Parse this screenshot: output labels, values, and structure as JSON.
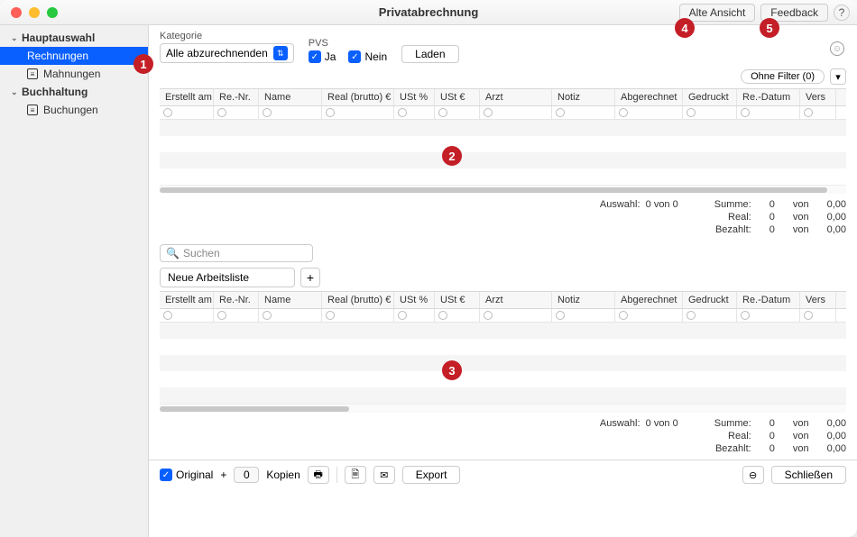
{
  "window_title": "Privatabrechnung",
  "titlebar_buttons": {
    "old_view": "Alte Ansicht",
    "feedback": "Feedback"
  },
  "sidebar": {
    "groups": [
      {
        "label": "Hauptauswahl",
        "items": [
          {
            "label": "Rechnungen",
            "active": true
          },
          {
            "label": "Mahnungen",
            "active": false
          }
        ]
      },
      {
        "label": "Buchhaltung",
        "items": [
          {
            "label": "Buchungen",
            "active": false
          }
        ]
      }
    ]
  },
  "filters": {
    "kategorie_label": "Kategorie",
    "kategorie_value": "Alle abzurechnenden",
    "pvs_label": "PVS",
    "pvs_ja": "Ja",
    "pvs_nein": "Nein",
    "load_btn": "Laden",
    "ohne_filter": "Ohne Filter (0)"
  },
  "columns": [
    "Erstellt am",
    "Re.-Nr.",
    "Name",
    "Real (brutto) €",
    "USt %",
    "USt €",
    "Arzt",
    "Notiz",
    "Abgerechnet",
    "Gedruckt",
    "Re.-Datum",
    "Vers"
  ],
  "summary": {
    "auswahl_label": "Auswahl:",
    "auswahl_value": "0 von 0",
    "rows": [
      {
        "label": "Summe:",
        "v1": "0",
        "von": "von",
        "v2": "0,00"
      },
      {
        "label": "Real:",
        "v1": "0",
        "von": "von",
        "v2": "0,00"
      },
      {
        "label": "Bezahlt:",
        "v1": "0",
        "von": "von",
        "v2": "0,00"
      }
    ]
  },
  "search_placeholder": "Suchen",
  "worklist_value": "Neue Arbeitsliste",
  "footer": {
    "original": "Original",
    "plus": "+",
    "kopien_value": "0",
    "kopien": "Kopien",
    "export": "Export",
    "close": "Schließen"
  },
  "badges": {
    "b1": "1",
    "b2": "2",
    "b3": "3",
    "b4": "4",
    "b5": "5"
  }
}
